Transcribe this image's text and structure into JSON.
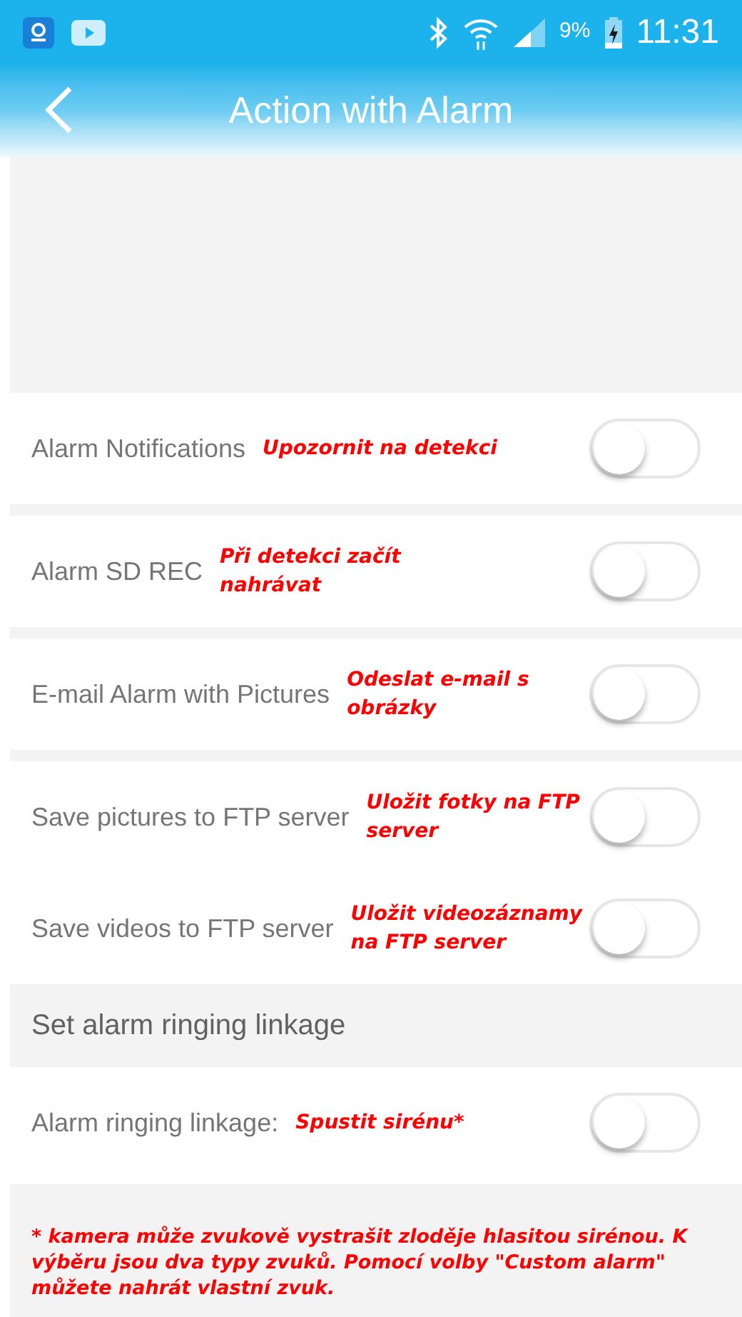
{
  "status_bar": {
    "battery": "9%",
    "time": "11:31"
  },
  "header": {
    "title": "Action with Alarm"
  },
  "groups": [
    {
      "kind": "toggles",
      "rows": [
        {
          "label": "Alarm Notifications",
          "note": "Upozornit na detekci",
          "on": false
        }
      ]
    },
    {
      "kind": "toggles",
      "rows": [
        {
          "label": "Alarm SD REC",
          "note": "Při detekci začít nahrávat",
          "on": false
        }
      ]
    },
    {
      "kind": "toggles",
      "rows": [
        {
          "label": "E-mail Alarm with Pictures",
          "note": "Odeslat e-mail s obrázky",
          "on": false
        }
      ]
    },
    {
      "kind": "toggles",
      "rows": [
        {
          "label": "Save pictures to FTP server",
          "note": "Uložit fotky na FTP server",
          "on": false
        },
        {
          "label": "Save videos to FTP server",
          "note": "Uložit videozáznamy na FTP server",
          "on": false
        }
      ]
    },
    {
      "kind": "header",
      "label": "Set alarm ringing linkage"
    },
    {
      "kind": "toggles",
      "rows": [
        {
          "label": "Alarm ringing linkage:",
          "note": "Spustit sirénu*",
          "on": false
        }
      ]
    }
  ],
  "footnote": "* kamera může zvukově vystrašit zloděje hlasitou sirénou. K výběru jsou dva typy zvuků. Pomocí volby \"Custom alarm\" můžete nahrát vlastní zvuk."
}
